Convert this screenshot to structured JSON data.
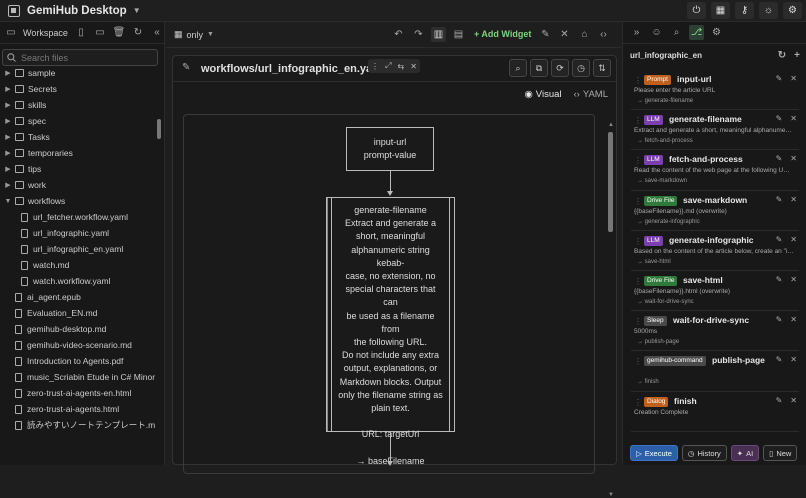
{
  "app": {
    "title": "GemiHub Desktop"
  },
  "sidebar": {
    "workspace_label": "Workspace",
    "search_placeholder": "Search files",
    "items": [
      {
        "label": "sample",
        "type": "folder",
        "indent": 0
      },
      {
        "label": "Secrets",
        "type": "folder",
        "indent": 0
      },
      {
        "label": "skills",
        "type": "folder",
        "indent": 0
      },
      {
        "label": "spec",
        "type": "folder",
        "indent": 0
      },
      {
        "label": "Tasks",
        "type": "folder",
        "indent": 0
      },
      {
        "label": "temporaries",
        "type": "folder",
        "indent": 0
      },
      {
        "label": "tips",
        "type": "folder",
        "indent": 0
      },
      {
        "label": "work",
        "type": "folder",
        "indent": 0
      },
      {
        "label": "workflows",
        "type": "folder-open",
        "indent": 0
      },
      {
        "label": "url_fetcher.workflow.yaml",
        "type": "file",
        "indent": 1
      },
      {
        "label": "url_infographic.yaml",
        "type": "file",
        "indent": 1
      },
      {
        "label": "url_infographic_en.yaml",
        "type": "file",
        "indent": 1
      },
      {
        "label": "watch.md",
        "type": "file",
        "indent": 1
      },
      {
        "label": "watch.workflow.yaml",
        "type": "file",
        "indent": 1
      },
      {
        "label": "ai_agent.epub",
        "type": "file",
        "indent": 0
      },
      {
        "label": "Evaluation_EN.md",
        "type": "file",
        "indent": 0
      },
      {
        "label": "gemihub-desktop.md",
        "type": "file",
        "indent": 0
      },
      {
        "label": "gemihub-video-scenario.md",
        "type": "file",
        "indent": 0
      },
      {
        "label": "Introduction to Agents.pdf",
        "type": "file",
        "indent": 0
      },
      {
        "label": "music_Scriabin Etude in C# Minor, Op. ...",
        "type": "file",
        "indent": 0
      },
      {
        "label": "zero-trust-ai-agents-en.html",
        "type": "file",
        "indent": 0
      },
      {
        "label": "zero-trust-ai-agents.html",
        "type": "file",
        "indent": 0
      },
      {
        "label": "読みやすいノートテンプレート.md",
        "type": "file",
        "indent": 0
      }
    ]
  },
  "toolbar": {
    "layout_label": "only",
    "add_widget_label": "+ Add Widget"
  },
  "editor": {
    "path": "workflows/url_infographic_en.yaml",
    "view_visual": "Visual",
    "view_yaml": "YAML",
    "node1_lines": [
      "input-url",
      "prompt-value"
    ],
    "node2_lines": [
      "generate-filename",
      "Extract and generate a",
      "short, meaningful",
      "alphanumeric string kebab-",
      "case, no extension, no",
      "special characters that can",
      "be used as a filename from",
      "the following URL.",
      "Do not include any extra",
      "output, explanations, or",
      "Markdown blocks. Output",
      "only the filename string as",
      "plain text.",
      "",
      "URL: targetUrl",
      "",
      "→ baseFilename"
    ]
  },
  "right_panel": {
    "workflow_name": "url_infographic_en",
    "steps": [
      {
        "badge": "Prompt",
        "badge_color": "#c0601a",
        "name": "input-url",
        "desc": "Please enter the article URL",
        "next": "→ generate-filename"
      },
      {
        "badge": "LLM",
        "badge_color": "#7b3fb0",
        "name": "generate-filename",
        "desc": "Extract and generate a short, meaningful alphanumeric strin...",
        "next": "→ fetch-and-process"
      },
      {
        "badge": "LLM",
        "badge_color": "#7b3fb0",
        "name": "fetch-and-process",
        "desc": "Read the content of the web page at the following URL and ...",
        "next": "→ save-markdown"
      },
      {
        "badge": "Drive File",
        "badge_color": "#2f7a3a",
        "name": "save-markdown",
        "desc": "{{baseFilename}}.md (overwrite)",
        "next": "→ generate-infographic"
      },
      {
        "badge": "LLM",
        "badge_color": "#7b3fb0",
        "name": "generate-infographic",
        "desc": "Based on the content of the article below, create an \"infog...",
        "next": "→ save-html"
      },
      {
        "badge": "Drive File",
        "badge_color": "#2f7a3a",
        "name": "save-html",
        "desc": "{{baseFilename}}.html (overwrite)",
        "next": "→ wait-for-drive-sync"
      },
      {
        "badge": "Sleep",
        "badge_color": "#4a4a4a",
        "name": "wait-for-drive-sync",
        "desc": "5000ms",
        "next": "→ publish-page"
      },
      {
        "badge": "gemihub-command",
        "badge_color": "#4a4a4a",
        "name": "publish-page",
        "desc": "",
        "next": "→ finish"
      },
      {
        "badge": "Dialog",
        "badge_color": "#c0601a",
        "name": "finish",
        "desc": "Creation Complete",
        "next": ""
      }
    ],
    "buttons": {
      "execute": "Execute",
      "history": "History",
      "ai": "AI",
      "new": "New"
    }
  }
}
